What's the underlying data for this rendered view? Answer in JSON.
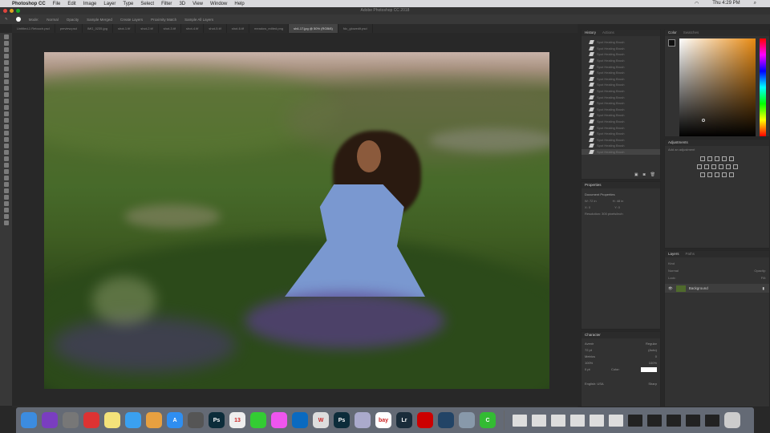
{
  "menubar": {
    "apple": "",
    "app": "Photoshop CC",
    "items": [
      "File",
      "Edit",
      "Image",
      "Layer",
      "Type",
      "Select",
      "Filter",
      "3D",
      "View",
      "Window",
      "Help"
    ],
    "clock": "Thu 4:29 PM"
  },
  "window": {
    "title": "Adobe Photoshop CC 2018"
  },
  "options": {
    "items": [
      "Mode:",
      "Normal",
      "Opacity",
      "Sample Merged",
      "Create Layers",
      "Proximity Match",
      "Sample All Layers"
    ]
  },
  "tabs": [
    {
      "label": "Untitled-1 Retouch.psd"
    },
    {
      "label": "preview.psd"
    },
    {
      "label": "IMG_0235.jpg"
    },
    {
      "label": "shot-1.tif"
    },
    {
      "label": "shot-2.tif"
    },
    {
      "label": "shot-3.tif"
    },
    {
      "label": "shot-4.tif"
    },
    {
      "label": "shot-5.tif"
    },
    {
      "label": "shot-6.tif"
    },
    {
      "label": "meadow_edited.png"
    },
    {
      "label": "sh4-17.jpg @ 50% (RGB/8)",
      "active": true
    },
    {
      "label": "fdc_glowedit.psd"
    }
  ],
  "history": {
    "tabs": [
      "History",
      "Actions"
    ],
    "items": [
      "Spot Healing Brush",
      "Spot Healing Brush",
      "Spot Healing Brush",
      "Spot Healing Brush",
      "Spot Healing Brush",
      "Spot Healing Brush",
      "Spot Healing Brush",
      "Spot Healing Brush",
      "Spot Healing Brush",
      "Spot Healing Brush",
      "Spot Healing Brush",
      "Spot Healing Brush",
      "Spot Healing Brush",
      "Spot Healing Brush",
      "Spot Healing Brush",
      "Spot Healing Brush",
      "Spot Healing Brush",
      "Spot Healing Brush",
      "Spot Healing Brush"
    ]
  },
  "color": {
    "tabs": [
      "Color",
      "Swatches"
    ],
    "hue": "#e88a12"
  },
  "adjustments": {
    "title": "Adjustments",
    "subtitle": "Add an adjustment"
  },
  "properties": {
    "title": "Properties",
    "doc": "Document Properties",
    "w": "W: 72 in",
    "h": "H: 48 in",
    "x": "X: 0",
    "y": "Y: 0",
    "res": "Resolution: 300 pixels/inch"
  },
  "layers": {
    "tabs": [
      "Layers",
      "Paths"
    ],
    "kind": "Kind",
    "mode": "Normal",
    "opacity": "Opacity:",
    "lock": "Lock:",
    "fill": "Fill:",
    "layer": "Background"
  },
  "character": {
    "title": "Character",
    "font": "Avenir",
    "style": "Regular",
    "size": "72 pt",
    "leading": "(Auto)",
    "kerning": "Metrics",
    "tracking": "0",
    "vscale": "100%",
    "hscale": "100%",
    "baseline": "0 pt",
    "color_label": "Color:",
    "lang": "English: USA",
    "aa": "Sharp"
  },
  "dock": {
    "apps": [
      {
        "n": "finder",
        "c": "#3c8ce0",
        "t": ""
      },
      {
        "n": "siri",
        "c": "#7a3ec0",
        "t": ""
      },
      {
        "n": "launchpad",
        "c": "#777",
        "t": ""
      },
      {
        "n": "chrome",
        "c": "#d33",
        "t": ""
      },
      {
        "n": "notes",
        "c": "#f4e27a",
        "t": ""
      },
      {
        "n": "messages",
        "c": "#3aa0f0",
        "t": ""
      },
      {
        "n": "photos",
        "c": "#e7a040",
        "t": ""
      },
      {
        "n": "app-store",
        "c": "#2f8ef0",
        "t": "A"
      },
      {
        "n": "system-preferences",
        "c": "#555",
        "t": ""
      },
      {
        "n": "photoshop",
        "c": "#0c2c3a",
        "t": "Ps"
      },
      {
        "n": "calendar",
        "c": "#eee",
        "t": "13"
      },
      {
        "n": "facetime",
        "c": "#3c3",
        "t": ""
      },
      {
        "n": "itunes",
        "c": "#e5e",
        "t": ""
      },
      {
        "n": "trello",
        "c": "#0a6ac0",
        "t": ""
      },
      {
        "n": "wunderlist",
        "c": "#ddd",
        "t": "W"
      },
      {
        "n": "photoshop-2",
        "c": "#0c2c3a",
        "t": "Ps"
      },
      {
        "n": "preview",
        "c": "#aac",
        "t": ""
      },
      {
        "n": "ebay",
        "c": "#fff",
        "t": "bay"
      },
      {
        "n": "lightroom",
        "c": "#1a2c3a",
        "t": "Lr"
      },
      {
        "n": "acrobat",
        "c": "#c00",
        "t": ""
      },
      {
        "n": "quicktime",
        "c": "#246",
        "t": ""
      },
      {
        "n": "image-capture",
        "c": "#89a",
        "t": ""
      },
      {
        "n": "camtasia",
        "c": "#3b3",
        "t": "C"
      }
    ]
  }
}
